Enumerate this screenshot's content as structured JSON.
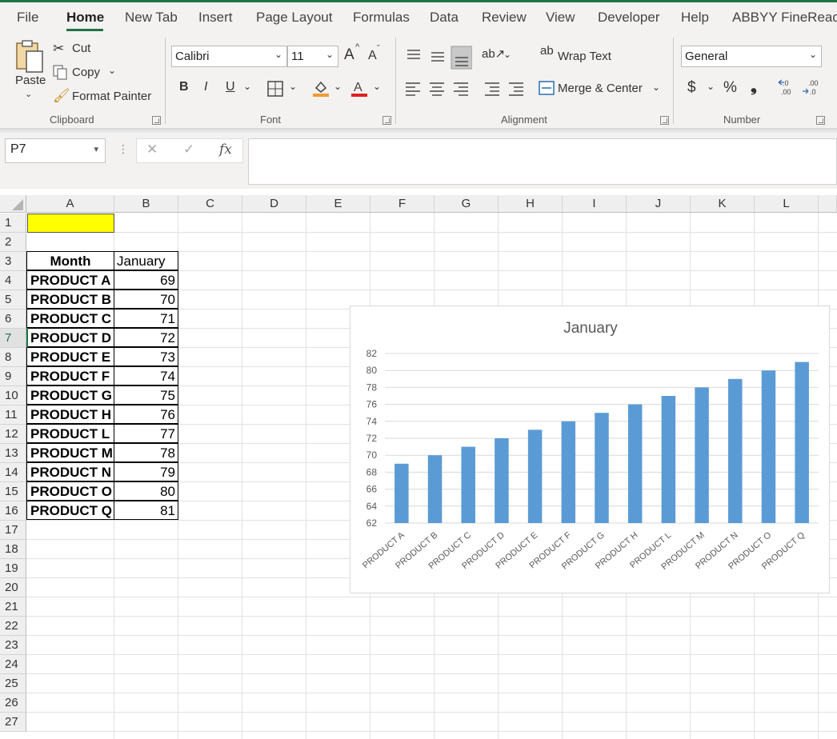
{
  "tabs": [
    "File",
    "Home",
    "New Tab",
    "Insert",
    "Page Layout",
    "Formulas",
    "Data",
    "Review",
    "View",
    "Developer",
    "Help",
    "ABBYY FineReader"
  ],
  "active_tab": "Home",
  "ribbon": {
    "clipboard": {
      "paste": "Paste",
      "cut": "Cut",
      "copy": "Copy",
      "format_painter": "Format Painter",
      "group_label": "Clipboard"
    },
    "font": {
      "font_name": "Calibri",
      "font_size": "11",
      "bold": "B",
      "italic": "I",
      "underline": "U",
      "grow": "A",
      "shrink": "A",
      "group_label": "Font"
    },
    "alignment": {
      "wrap_text": "Wrap Text",
      "merge_center": "Merge & Center",
      "group_label": "Alignment"
    },
    "number": {
      "format": "General",
      "currency": "$",
      "percent": "%",
      "comma": "❟",
      "group_label": "Number"
    }
  },
  "formula_bar": {
    "name_box": "P7",
    "fx": "fx",
    "formula": ""
  },
  "columns": [
    "A",
    "B",
    "C",
    "D",
    "E",
    "F",
    "G",
    "H",
    "I",
    "J",
    "K",
    "L"
  ],
  "rows": [
    "1",
    "2",
    "3",
    "4",
    "5",
    "6",
    "7",
    "8",
    "9",
    "10",
    "11",
    "12",
    "13",
    "14",
    "15",
    "16",
    "17",
    "18",
    "19",
    "20",
    "21",
    "22",
    "23",
    "24",
    "25",
    "26",
    "27"
  ],
  "table": {
    "header": [
      "Month",
      "January"
    ],
    "rows": [
      [
        "PRODUCT A",
        "69"
      ],
      [
        "PRODUCT B",
        "70"
      ],
      [
        "PRODUCT C",
        "71"
      ],
      [
        "PRODUCT D",
        "72"
      ],
      [
        "PRODUCT E",
        "73"
      ],
      [
        "PRODUCT F",
        "74"
      ],
      [
        "PRODUCT G",
        "75"
      ],
      [
        "PRODUCT H",
        "76"
      ],
      [
        "PRODUCT L",
        "77"
      ],
      [
        "PRODUCT M",
        "78"
      ],
      [
        "PRODUCT N",
        "79"
      ],
      [
        "PRODUCT O",
        "80"
      ],
      [
        "PRODUCT Q",
        "81"
      ]
    ]
  },
  "colors": {
    "accent": "#217346",
    "highlight": "#ffff00",
    "bar": "#5b9bd5"
  },
  "chart_data": {
    "type": "bar",
    "title": "January",
    "categories": [
      "PRODUCT A",
      "PRODUCT B",
      "PRODUCT C",
      "PRODUCT D",
      "PRODUCT E",
      "PRODUCT F",
      "PRODUCT G",
      "PRODUCT H",
      "PRODUCT L",
      "PRODUCT M",
      "PRODUCT N",
      "PRODUCT O",
      "PRODUCT Q"
    ],
    "values": [
      69,
      70,
      71,
      72,
      73,
      74,
      75,
      76,
      77,
      78,
      79,
      80,
      81
    ],
    "ylim": [
      62,
      82
    ],
    "yticks": [
      "62",
      "64",
      "66",
      "68",
      "70",
      "72",
      "74",
      "76",
      "78",
      "80",
      "82"
    ],
    "grid": true,
    "legend": "none"
  }
}
